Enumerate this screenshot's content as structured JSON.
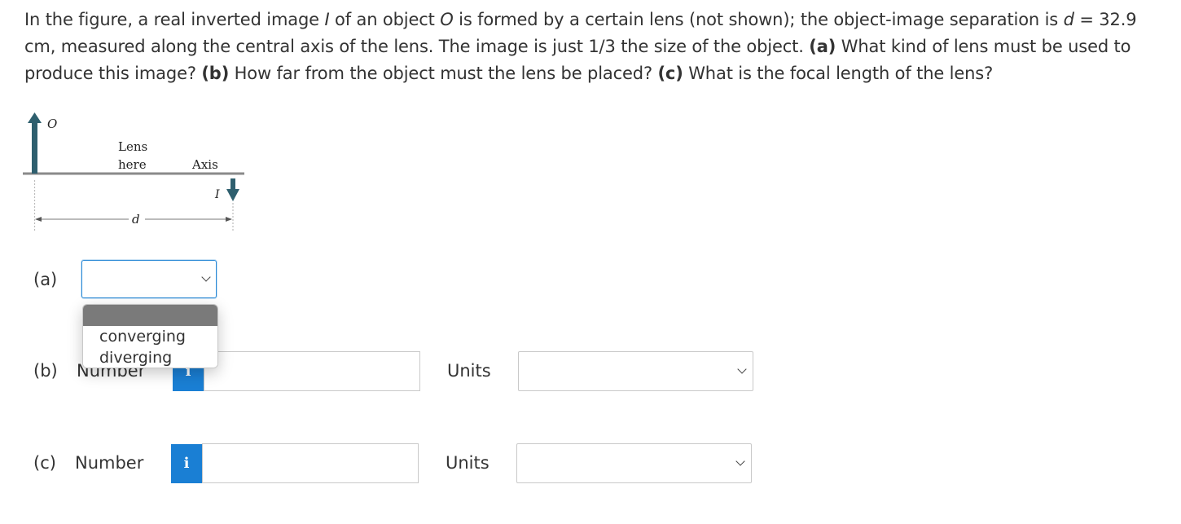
{
  "question": {
    "p1": "In the figure, a real inverted image ",
    "var_I": "I",
    "p2": " of an object ",
    "var_O": "O",
    "p3": " is formed by a certain lens (not shown); the object-image separation is ",
    "var_d": "d",
    "p4": " = 32.9 cm, measured along the central axis of the lens. The image is just 1/3 the size of the object. ",
    "a_tag": "(a)",
    "p5": " What kind of lens must be used to produce this image? ",
    "b_tag": "(b)",
    "p6": " How far from the object must the lens be placed? ",
    "c_tag": "(c)",
    "p7": " What is the focal length of the lens?"
  },
  "figure": {
    "object_label": "O",
    "lens_label_1": "Lens",
    "lens_label_2": "here",
    "axis_label": "Axis",
    "image_label": "I",
    "distance_label": "d",
    "colors": {
      "arrow": "#2e5f6e",
      "axis": "#8a8a8a"
    }
  },
  "part_a": {
    "label": "(a)",
    "selected": "",
    "options": [
      "",
      "converging",
      "diverging"
    ],
    "dropdown_open": true
  },
  "part_b": {
    "label": "(b)",
    "number_label": "Number",
    "info_icon": "i",
    "value": "",
    "units_label": "Units",
    "units_selected": ""
  },
  "part_c": {
    "label": "(c)",
    "number_label": "Number",
    "info_icon": "i",
    "value": "",
    "units_label": "Units",
    "units_selected": ""
  },
  "colors": {
    "info_button": "#1a7fd4",
    "focus_border": "#2b8ad6",
    "text": "#333333"
  }
}
